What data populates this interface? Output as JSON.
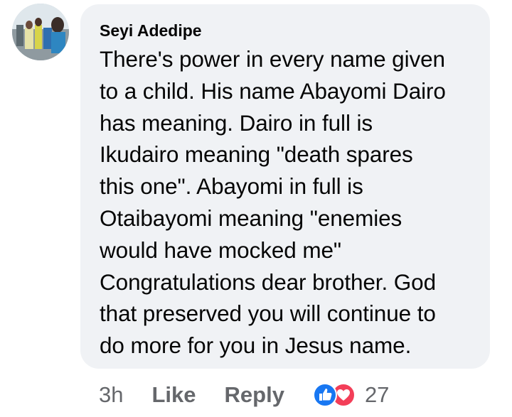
{
  "comment": {
    "author": "Seyi Adedipe",
    "text": "There's power in every name given\nto a child. His name Abayomi Dairo\nhas meaning. Dairo in full is\nIkudairo meaning \"death spares\nthis one\". Abayomi in full is\nOtaibayomi meaning \"enemies\nwould have mocked me\"\nCongratulations dear brother. God\nthat preserved you will continue to\ndo more for you in Jesus name.",
    "avatar_icon": "profile-photo-avatar"
  },
  "actions": {
    "time": "3h",
    "like_label": "Like",
    "reply_label": "Reply",
    "reaction_count": "27",
    "reaction_icons": [
      "like-reaction-icon",
      "love-reaction-icon"
    ]
  },
  "colors": {
    "bubble": "#f0f2f5",
    "text": "#050505",
    "secondary": "#65676b",
    "like_blue": "#1877f2",
    "love_red": "#f33e58"
  }
}
